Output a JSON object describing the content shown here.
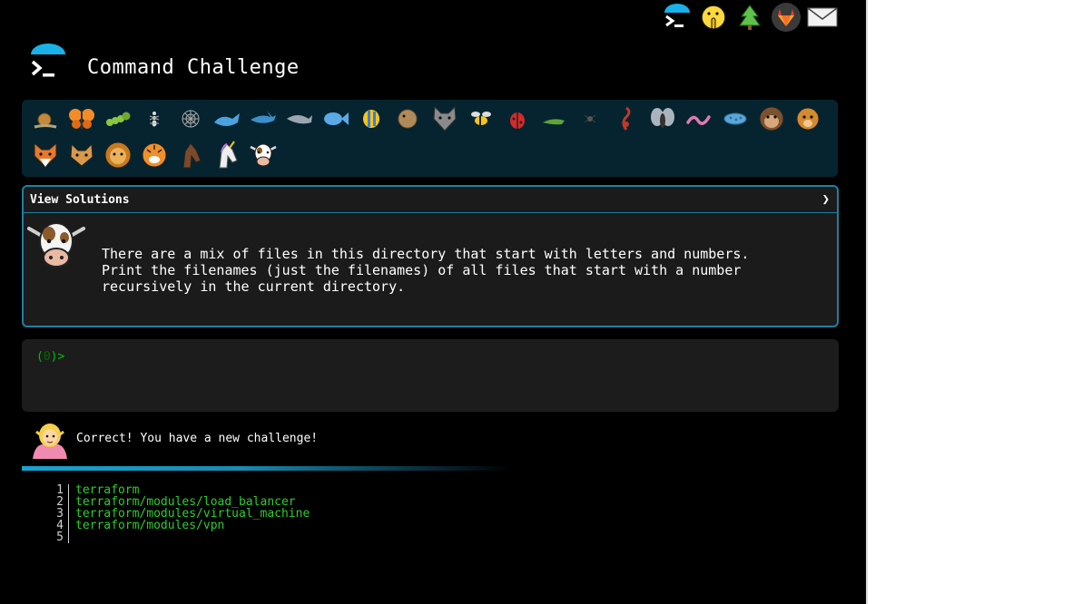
{
  "header": {
    "title": "Command Challenge"
  },
  "top_icons": [
    "terminal-logo-icon",
    "shushing-face-icon",
    "evergreen-tree-icon",
    "gitlab-icon",
    "envelope-icon"
  ],
  "animals": {
    "row1": [
      "snail-icon",
      "butterfly-icon",
      "caterpillar-icon",
      "ant-icon",
      "spider-web-icon",
      "whale-icon",
      "shark-icon",
      "dolphin-icon",
      "fish-icon",
      "tropical-fish-icon",
      "blowfish-icon",
      "wolf-icon",
      "bee-icon",
      "ladybug-icon",
      "cricket-icon",
      "spider-icon",
      "scorpion-icon",
      "fly-icon",
      "worm-icon",
      "microbe-icon",
      "monkey-icon",
      "dog-icon"
    ],
    "row2": [
      "fox-icon",
      "cat-icon",
      "lion-icon",
      "tiger-icon",
      "horse-icon",
      "unicorn-icon",
      "cow-icon"
    ]
  },
  "solutions": {
    "header_label": "View Solutions",
    "chevron": "❯",
    "challenge_text": "There are a mix of files in this directory that start with letters and numbers.\nPrint the filenames (just the filenames) of all files that start with a number\nrecursively in the current directory."
  },
  "terminal": {
    "prompt_open": "(",
    "prompt_count": "0",
    "prompt_close": ")>"
  },
  "response": {
    "message": "Correct! You have a new challenge!"
  },
  "output": {
    "lines": [
      {
        "num": "1",
        "text": "terraform"
      },
      {
        "num": "2",
        "text": "terraform/modules/load_balancer"
      },
      {
        "num": "3",
        "text": "terraform/modules/virtual_machine"
      },
      {
        "num": "4",
        "text": "terraform/modules/vpn"
      },
      {
        "num": "5",
        "text": ""
      }
    ]
  },
  "colors": {
    "accent": "#1e7fa3",
    "output_green": "#2ad02a",
    "prompt_green": "#00c000",
    "animals_bg": "#06242f"
  }
}
